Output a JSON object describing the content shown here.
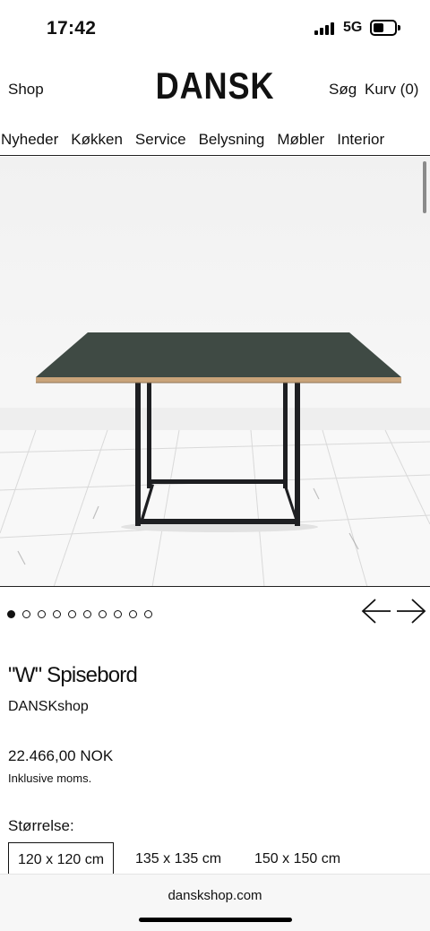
{
  "status_bar": {
    "time": "17:42",
    "network": "5G",
    "signal_icon": "cellular-signal-icon",
    "battery_icon": "battery-icon"
  },
  "header": {
    "shop_label": "Shop",
    "logo_text": "DANSK",
    "search_label": "Søg",
    "cart_label": "Kurv (0)"
  },
  "categories": [
    "Nyheder",
    "Køkken",
    "Service",
    "Belysning",
    "Møbler",
    "Interior"
  ],
  "gallery": {
    "image_subject": "green-dining-table-photo",
    "slide_count": 10,
    "active_slide": 1,
    "prev_icon": "arrow-left-icon",
    "next_icon": "arrow-right-icon"
  },
  "product": {
    "title": "\"W\" Spisebord",
    "vendor": "DANSKshop",
    "price": "22.466,00 NOK",
    "tax_note": "Inklusive moms.",
    "size_label": "Størrelse:",
    "sizes": [
      "120 x 120 cm",
      "135 x 135 cm",
      "150 x 150 cm"
    ],
    "selected_size_index": 0
  },
  "browser": {
    "url": "danskshop.com"
  },
  "colors": {
    "text": "#111111",
    "table_top": "#3f4a44",
    "table_edge": "#c9a47a",
    "frame": "#1e1f22"
  }
}
